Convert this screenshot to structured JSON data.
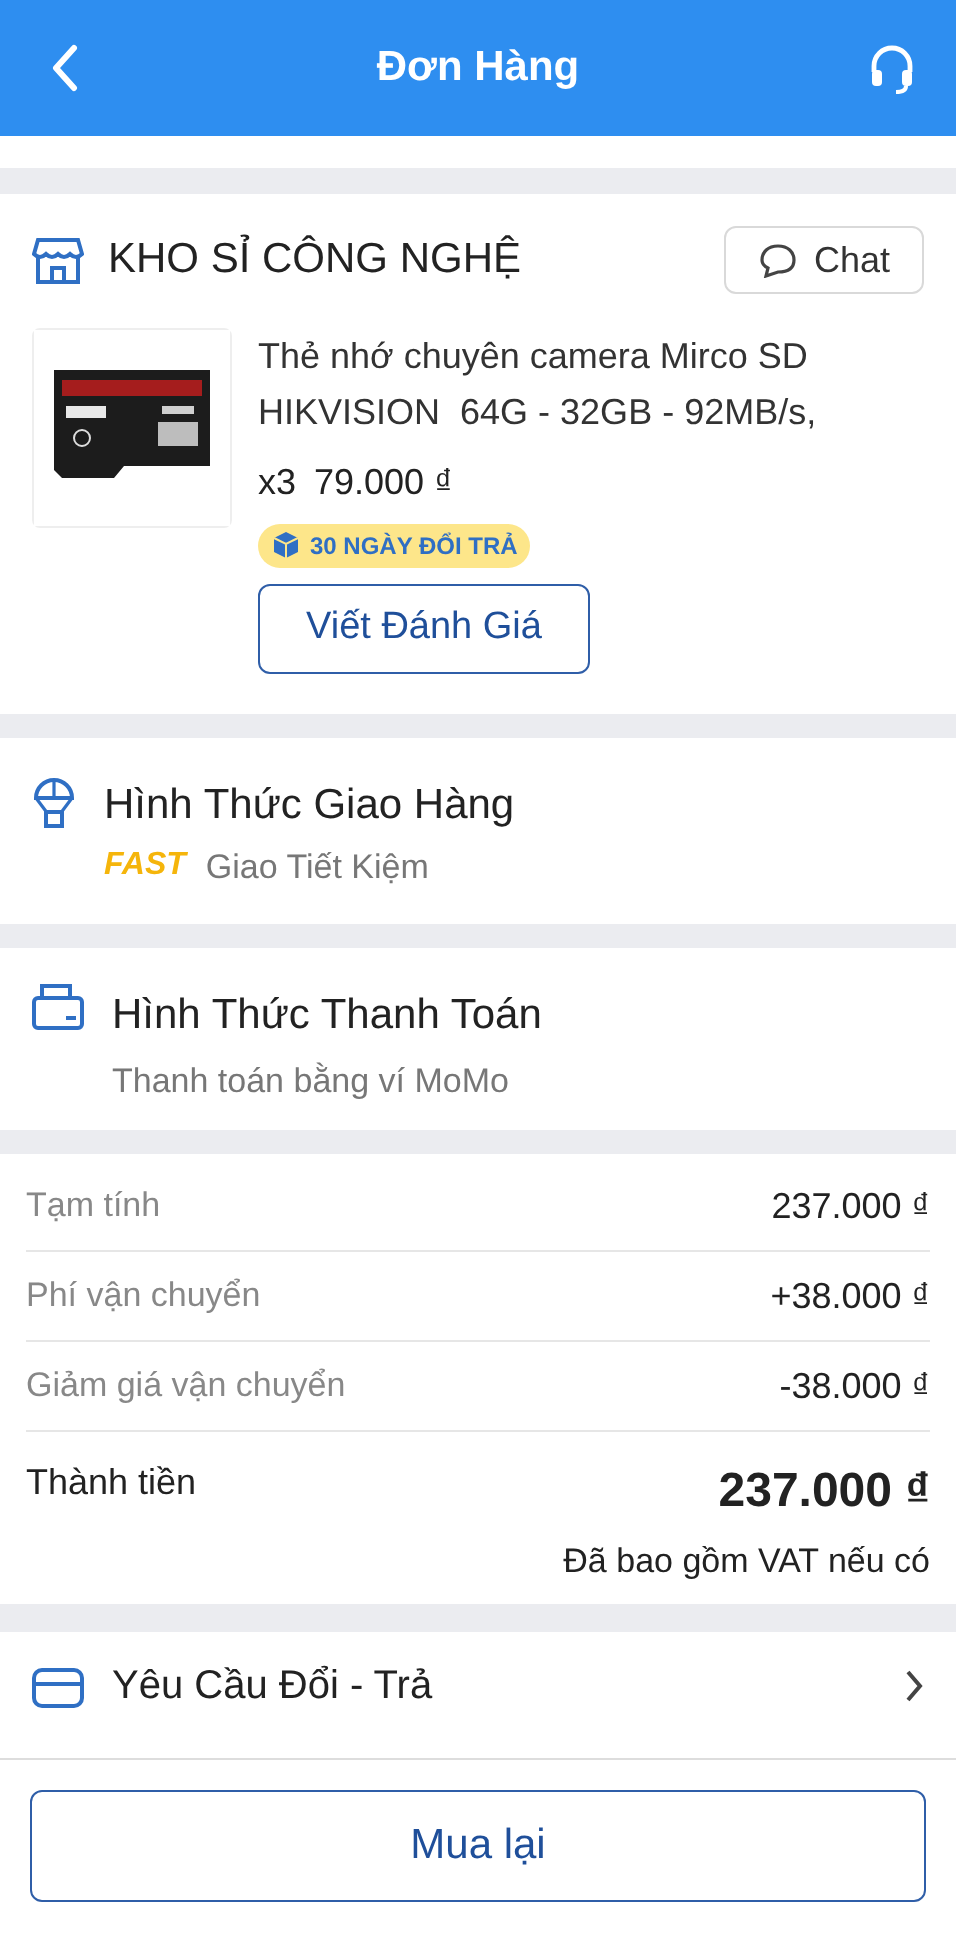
{
  "header": {
    "title": "Đơn Hàng"
  },
  "shop": {
    "name": "KHO SỈ CÔNG NGHỆ",
    "chat_label": "Chat"
  },
  "product": {
    "kind": "picture",
    "name": "Thẻ nhớ chuyên camera Mirco SD HIKVISION  64G - 32GB - 92MB/s,",
    "quantity": "x3",
    "price": "79.000 ₫",
    "return_badge": "30 NGÀY ĐỔI TRẢ",
    "review_button": "Viết Đánh Giá"
  },
  "shipping": {
    "title": "Hình Thức Giao Hàng",
    "tag": "FAST",
    "method": "Giao Tiết Kiệm"
  },
  "payment": {
    "title": "Hình Thức Thanh Toán",
    "method": "Thanh toán bằng ví MoMo"
  },
  "summary": {
    "rows": [
      {
        "label": "Tạm tính",
        "value": "237.000 ₫"
      },
      {
        "label": "Phí vận chuyển",
        "value": "+38.000 ₫"
      },
      {
        "label": "Giảm giá vận chuyển",
        "value": "-38.000 ₫"
      }
    ],
    "total_label": "Thành tiền",
    "total_value": "237.000 ₫",
    "vat_note": "Đã bao gồm VAT nếu có"
  },
  "return_request": {
    "label": "Yêu Cầu Đổi - Trả"
  },
  "footer": {
    "buy_again_button": "Mua lại"
  }
}
